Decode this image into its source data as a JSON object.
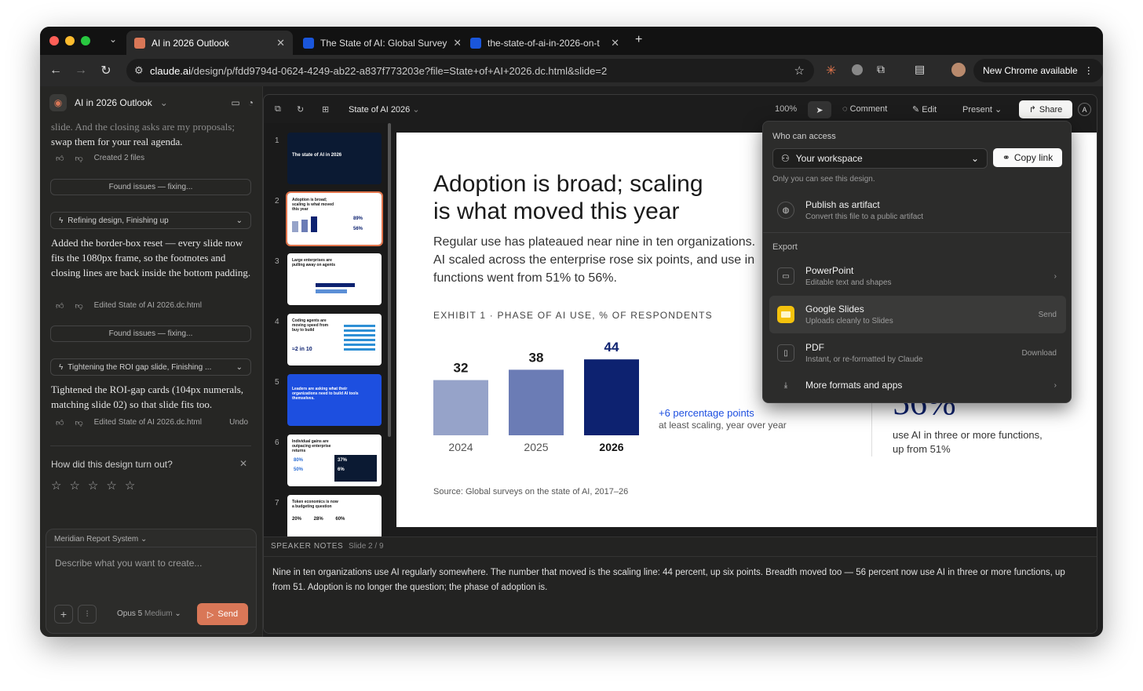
{
  "browser": {
    "tabs": [
      {
        "title": "AI in 2026 Outlook"
      },
      {
        "title": "The State of AI: Global Survey"
      },
      {
        "title": "the-state-of-ai-in-2026-on-t"
      }
    ],
    "url_domain": "claude.ai",
    "url_path": "/design/p/fdd9794d-0624-4249-ab22-a837f773203e?file=State+of+AI+2026.dc.html&slide=2",
    "chrome_update": "New Chrome available"
  },
  "sidebar": {
    "project": "AI in 2026 Outlook",
    "msg0": "slide. And the closing asks are my proposals;",
    "msg0b": "swap them for your real agenda.",
    "created": "Created 2 files",
    "found1": "Found issues — fixing...",
    "task1": "Refining design, Finishing up",
    "msg1": "Added the border-box reset — every slide now fits the 1080px frame, so the footnotes and closing lines are back inside the bottom padding.",
    "edited1": "Edited State of AI 2026.dc.html",
    "found2": "Found issues — fixing...",
    "task2": "Tightening the ROI gap slide, Finishing ...",
    "msg2": "Tightened the ROI-gap cards (104px numerals, matching slide 02) so that slide fits too.",
    "edited2": "Edited State of AI 2026.dc.html",
    "undo": "Undo",
    "feedback": "How did this design turn out?",
    "system": "Meridian Report System",
    "placeholder": "Describe what you want to create...",
    "model": "Opus 5",
    "effort": "Medium",
    "send": "Send"
  },
  "toolbar": {
    "file": "State of AI 2026",
    "zoom": "100%",
    "comment": "Comment",
    "edit": "Edit",
    "present": "Present",
    "share": "Share",
    "avatar": "A"
  },
  "thumbnails": [
    {
      "n": "1",
      "title": "The state of AI in 2026"
    },
    {
      "n": "2",
      "title": "Adoption is broad; scaling is what moved this year"
    },
    {
      "n": "3",
      "title": "Large enterprises are pulling away on agents"
    },
    {
      "n": "4",
      "title": "Coding agents are moving speed from buy to build"
    },
    {
      "n": "5",
      "title": "Leaders are asking what their organizations need to build AI tools themselves."
    },
    {
      "n": "6",
      "title": "Individual gains are outpacing enterprise returns"
    },
    {
      "n": "7",
      "title": "Token economics is now a budgeting question"
    }
  ],
  "slide": {
    "title1": "Adoption is broad; scaling",
    "title2": "is what moved this year",
    "body1": "Regular use has plateaued near nine in ten organizations.",
    "body2": "AI scaled across the enterprise rose six points, and use in",
    "body3": "functions went from 51% to 56%.",
    "exhibit": "EXHIBIT 1 · PHASE OF AI USE, % OF RESPONDENTS",
    "delta": "+6 percentage points",
    "delta_sub": "at least scaling, year over year",
    "big": "56%",
    "big_sub1": "use AI in three or more functions,",
    "big_sub2": "up from 51%",
    "source": "Source: Global surveys on the state of AI, 2017–26"
  },
  "chart_data": {
    "type": "bar",
    "categories": [
      "2024",
      "2025",
      "2026"
    ],
    "values": [
      32,
      38,
      44
    ],
    "title": "EXHIBIT 1 · PHASE OF AI USE, % OF RESPONDENTS",
    "colors": [
      "#96a3c9",
      "#6b7cb5",
      "#0d2270"
    ]
  },
  "notes": {
    "label": "SPEAKER NOTES",
    "slide": "Slide 2 / 9",
    "text": "Nine in ten organizations use AI regularly somewhere. The number that moved is the scaling line: 44 percent, up six points. Breadth moved too — 56 percent now use AI in three or more functions, up from 51. Adoption is no longer the question; the phase of adoption is."
  },
  "share": {
    "who": "Who can access",
    "workspace": "Your workspace",
    "copy": "Copy link",
    "only": "Only you can see this design.",
    "publish": "Publish as artifact",
    "publish_sub": "Convert this file to a public artifact",
    "export": "Export",
    "items": [
      {
        "t": "PowerPoint",
        "s": "Editable text and shapes",
        "r": "›"
      },
      {
        "t": "Google Slides",
        "s": "Uploads cleanly to Slides",
        "r": "Send"
      },
      {
        "t": "PDF",
        "s": "Instant, or re-formatted by Claude",
        "r": "Download"
      },
      {
        "t": "More formats and apps",
        "s": "",
        "r": "›"
      }
    ]
  }
}
